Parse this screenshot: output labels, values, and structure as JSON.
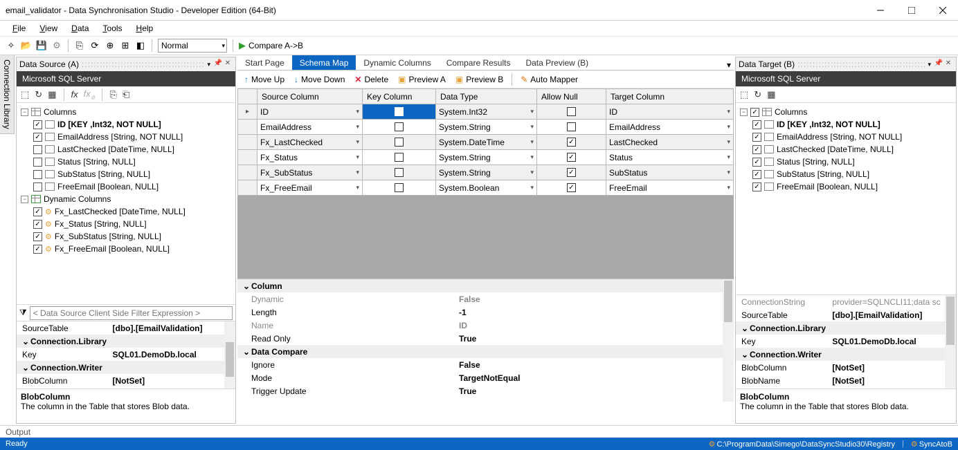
{
  "window": {
    "title": "email_validator - Data Synchronisation Studio - Developer Edition (64-Bit)"
  },
  "menu": {
    "file": "File",
    "view": "View",
    "data": "Data",
    "tools": "Tools",
    "help": "Help"
  },
  "toolbar": {
    "mode": "Normal",
    "compare": "Compare A->B"
  },
  "tabs": {
    "start": "Start Page",
    "schema": "Schema Map",
    "dyn": "Dynamic Columns",
    "cmp": "Compare Results",
    "prev": "Data Preview (B)"
  },
  "sm_tb": {
    "up": "Move Up",
    "down": "Move Down",
    "del": "Delete",
    "pa": "Preview A",
    "pb": "Preview B",
    "auto": "Auto Mapper"
  },
  "grid": {
    "headers": {
      "src": "Source Column",
      "key": "Key Column",
      "type": "Data Type",
      "null": "Allow Null",
      "tgt": "Target Column"
    },
    "rows": [
      {
        "src": "ID",
        "key": true,
        "type": "System.Int32",
        "null": false,
        "tgt": "ID",
        "sel": true
      },
      {
        "src": "EmailAddress",
        "key": false,
        "type": "System.String",
        "null": false,
        "tgt": "EmailAddress"
      },
      {
        "src": "Fx_LastChecked",
        "key": false,
        "type": "System.DateTime",
        "null": true,
        "tgt": "LastChecked"
      },
      {
        "src": "Fx_Status",
        "key": false,
        "type": "System.String",
        "null": true,
        "tgt": "Status"
      },
      {
        "src": "Fx_SubStatus",
        "key": false,
        "type": "System.String",
        "null": true,
        "tgt": "SubStatus"
      },
      {
        "src": "Fx_FreeEmail",
        "key": false,
        "type": "System.Boolean",
        "null": true,
        "tgt": "FreeEmail"
      }
    ]
  },
  "left": {
    "title": "Data Source (A)",
    "provider": "Microsoft SQL Server",
    "filter_placeholder": "< Data Source Client Side Filter Expression >",
    "tree": {
      "columns_label": "Columns",
      "cols": [
        {
          "checked": true,
          "label": "ID [KEY ,Int32, NOT NULL]",
          "bold": true
        },
        {
          "checked": true,
          "label": "EmailAddress [String, NOT NULL]"
        },
        {
          "checked": false,
          "label": "LastChecked [DateTime, NULL]"
        },
        {
          "checked": false,
          "label": "Status [String, NULL]"
        },
        {
          "checked": false,
          "label": "SubStatus [String, NULL]"
        },
        {
          "checked": false,
          "label": "FreeEmail [Boolean, NULL]"
        }
      ],
      "dyn_label": "Dynamic Columns",
      "dyn": [
        {
          "checked": true,
          "label": "Fx_LastChecked [DateTime, NULL]"
        },
        {
          "checked": true,
          "label": "Fx_Status [String, NULL]"
        },
        {
          "checked": true,
          "label": "Fx_SubStatus [String, NULL]"
        },
        {
          "checked": true,
          "label": "Fx_FreeEmail [Boolean, NULL]"
        }
      ]
    },
    "props": [
      {
        "cat": false,
        "name": "SourceTable",
        "val": "[dbo].[EmailValidation]",
        "bold": true
      },
      {
        "cat": true,
        "name": "Connection.Library",
        "val": ""
      },
      {
        "cat": false,
        "name": "Key",
        "val": "SQL01.DemoDb.local",
        "bold": true
      },
      {
        "cat": true,
        "name": "Connection.Writer",
        "val": ""
      },
      {
        "cat": false,
        "name": "BlobColumn",
        "val": "[NotSet]",
        "bold": true
      }
    ],
    "desc": {
      "title": "BlobColumn",
      "body": "The column in the Table that stores Blob data."
    }
  },
  "right": {
    "title": "Data Target (B)",
    "provider": "Microsoft SQL Server",
    "tree": {
      "columns_label": "Columns",
      "cols": [
        {
          "checked": true,
          "label": "ID [KEY ,Int32, NOT NULL]",
          "bold": true
        },
        {
          "checked": true,
          "label": "EmailAddress [String, NOT NULL]"
        },
        {
          "checked": true,
          "label": "LastChecked [DateTime, NULL]"
        },
        {
          "checked": true,
          "label": "Status [String, NULL]"
        },
        {
          "checked": true,
          "label": "SubStatus [String, NULL]"
        },
        {
          "checked": true,
          "label": "FreeEmail [Boolean, NULL]"
        }
      ]
    },
    "props": [
      {
        "cat": false,
        "name": "ConnectionString",
        "val": "provider=SQLNCLI11;data sc",
        "grey": true
      },
      {
        "cat": false,
        "name": "SourceTable",
        "val": "[dbo].[EmailValidation]",
        "bold": true
      },
      {
        "cat": true,
        "name": "Connection.Library",
        "val": ""
      },
      {
        "cat": false,
        "name": "Key",
        "val": "SQL01.DemoDb.local",
        "bold": true
      },
      {
        "cat": true,
        "name": "Connection.Writer",
        "val": ""
      },
      {
        "cat": false,
        "name": "BlobColumn",
        "val": "[NotSet]",
        "bold": true
      },
      {
        "cat": false,
        "name": "BlobName",
        "val": "[NotSet]",
        "bold": true
      }
    ],
    "desc": {
      "title": "BlobColumn",
      "body": "The column in the Table that stores Blob data."
    }
  },
  "lower": {
    "cats": [
      {
        "cat": true,
        "name": "Column"
      },
      {
        "name": "Dynamic",
        "val": "False",
        "grey": true
      },
      {
        "name": "Length",
        "val": "-1"
      },
      {
        "name": "Name",
        "val": "ID",
        "grey": true
      },
      {
        "name": "Read Only",
        "val": "True"
      },
      {
        "cat": true,
        "name": "Data Compare"
      },
      {
        "name": "Ignore",
        "val": "False"
      },
      {
        "name": "Mode",
        "val": "TargetNotEqual"
      },
      {
        "name": "Trigger Update",
        "val": "True"
      }
    ]
  },
  "sidebar_tab": "Connection Library",
  "output": "Output",
  "status": {
    "ready": "Ready",
    "path": "C:\\ProgramData\\Simego\\DataSyncStudio30\\Registry",
    "sync": "SyncAtoB"
  }
}
